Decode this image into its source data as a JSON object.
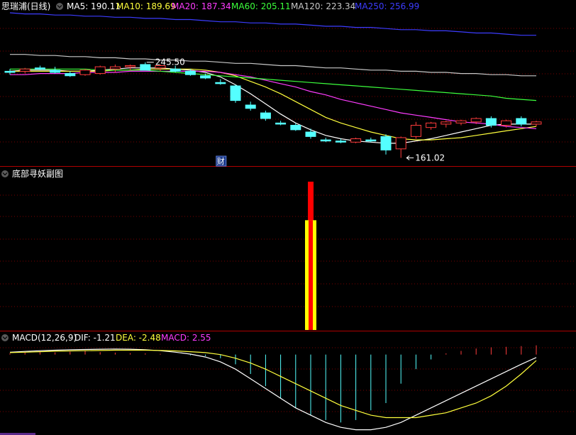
{
  "title": {
    "stock": "思瑞浦(日线)",
    "ma": [
      {
        "label": "MA5: 190.11",
        "color": "#ffffff"
      },
      {
        "label": "MA10: 189.69",
        "color": "#ffff3c"
      },
      {
        "label": "MA20: 187.34",
        "color": "#ff3cff"
      },
      {
        "label": "MA60: 205.11",
        "color": "#3cff3c"
      },
      {
        "label": "MA120: 223.34",
        "color": "#c8c8c8"
      },
      {
        "label": "MA250: 256.99",
        "color": "#3c3cff"
      }
    ]
  },
  "price_annotations": {
    "high": "245.50",
    "low": "161.02",
    "badge": "财"
  },
  "sub_panel": {
    "title": "底部寻妖副图"
  },
  "macd_panel": {
    "title": "MACD(12,26,9)",
    "dif": "DIF: -1.21",
    "dea": "DEA: -2.48",
    "macd": "MACD: 2.55",
    "colors": {
      "dif": "#ffffff",
      "dea": "#ffff3c",
      "macd": "#ff3cff"
    }
  },
  "chart_data": [
    {
      "type": "candlestick",
      "title": "思瑞浦(日线)",
      "ylim": [
        155,
        290
      ],
      "candles": [
        {
          "o": 238,
          "h": 240,
          "l": 235,
          "c": 237
        },
        {
          "o": 238,
          "h": 241,
          "l": 236,
          "c": 240
        },
        {
          "o": 241,
          "h": 243,
          "l": 239,
          "c": 240
        },
        {
          "o": 239,
          "h": 242,
          "l": 236,
          "c": 237
        },
        {
          "o": 236,
          "h": 238,
          "l": 233,
          "c": 234
        },
        {
          "o": 235,
          "h": 240,
          "l": 234,
          "c": 239
        },
        {
          "o": 236,
          "h": 243,
          "l": 235,
          "c": 242
        },
        {
          "o": 240,
          "h": 244,
          "l": 237,
          "c": 242
        },
        {
          "o": 242,
          "h": 244,
          "l": 239,
          "c": 243
        },
        {
          "o": 244,
          "h": 246,
          "l": 240,
          "c": 239
        },
        {
          "o": 241,
          "h": 244,
          "l": 238,
          "c": 243
        },
        {
          "o": 240,
          "h": 243,
          "l": 237,
          "c": 238
        },
        {
          "o": 238,
          "h": 240,
          "l": 234,
          "c": 235
        },
        {
          "o": 234,
          "h": 236,
          "l": 231,
          "c": 232
        },
        {
          "o": 228,
          "h": 231,
          "l": 226,
          "c": 227
        },
        {
          "o": 225,
          "h": 226,
          "l": 210,
          "c": 212
        },
        {
          "o": 208,
          "h": 211,
          "l": 203,
          "c": 205
        },
        {
          "o": 201,
          "h": 203,
          "l": 194,
          "c": 196
        },
        {
          "o": 192,
          "h": 194,
          "l": 190,
          "c": 191
        },
        {
          "o": 190,
          "h": 192,
          "l": 185,
          "c": 186
        },
        {
          "o": 184,
          "h": 187,
          "l": 178,
          "c": 180
        },
        {
          "o": 177,
          "h": 179,
          "l": 175,
          "c": 176
        },
        {
          "o": 176,
          "h": 178,
          "l": 174,
          "c": 175
        },
        {
          "o": 175,
          "h": 179,
          "l": 174,
          "c": 178
        },
        {
          "o": 177,
          "h": 179,
          "l": 175,
          "c": 176
        },
        {
          "o": 180,
          "h": 182,
          "l": 164,
          "c": 168
        },
        {
          "o": 169,
          "h": 180,
          "l": 161.02,
          "c": 179
        },
        {
          "o": 180,
          "h": 193,
          "l": 178,
          "c": 190
        },
        {
          "o": 188,
          "h": 193,
          "l": 186,
          "c": 192
        },
        {
          "o": 191,
          "h": 194,
          "l": 188,
          "c": 193
        },
        {
          "o": 192,
          "h": 195,
          "l": 190,
          "c": 194
        },
        {
          "o": 193,
          "h": 197,
          "l": 191,
          "c": 196
        },
        {
          "o": 196,
          "h": 198,
          "l": 188,
          "c": 190
        },
        {
          "o": 190,
          "h": 195,
          "l": 188,
          "c": 194
        },
        {
          "o": 196,
          "h": 198,
          "l": 189,
          "c": 191
        },
        {
          "o": 191,
          "h": 194,
          "l": 189,
          "c": 193
        }
      ],
      "ma_lines": [
        {
          "name": "MA5",
          "color": "#ffffff",
          "values": [
            238,
            239,
            239,
            239,
            238,
            238,
            239,
            240,
            241,
            241,
            241,
            240,
            239,
            237,
            233,
            226,
            218,
            209,
            200,
            192,
            186,
            181,
            178,
            176,
            175,
            174,
            174,
            176,
            178,
            181,
            184,
            187,
            190,
            191,
            191,
            191
          ]
        },
        {
          "name": "MA10",
          "color": "#ffff3c",
          "values": [
            238,
            238,
            238,
            238,
            238,
            238,
            238,
            239,
            239,
            240,
            240,
            240,
            240,
            239,
            237,
            234,
            229,
            224,
            218,
            211,
            204,
            197,
            192,
            188,
            184,
            181,
            178,
            177,
            177,
            178,
            179,
            181,
            183,
            185,
            187,
            189
          ]
        },
        {
          "name": "MA20",
          "color": "#ff3cff",
          "values": [
            235,
            235,
            236,
            236,
            236,
            237,
            237,
            237,
            238,
            238,
            238,
            238,
            238,
            238,
            237,
            235,
            233,
            230,
            227,
            224,
            220,
            217,
            213,
            210,
            207,
            204,
            201,
            199,
            197,
            195,
            193,
            192,
            191,
            189,
            188,
            187
          ]
        },
        {
          "name": "MA60",
          "color": "#3cff3c",
          "values": [
            240,
            240,
            240,
            240,
            240,
            240,
            239,
            239,
            239,
            239,
            238,
            237,
            236,
            235,
            234,
            233,
            232,
            231,
            230,
            229,
            228,
            227,
            226,
            225,
            224,
            223,
            222,
            221,
            220,
            219,
            218,
            217,
            216,
            214,
            213,
            212
          ]
        },
        {
          "name": "MA120",
          "color": "#c8c8c8",
          "values": [
            253,
            253,
            252,
            252,
            251,
            251,
            250,
            250,
            249,
            249,
            248,
            248,
            247,
            247,
            246,
            245,
            245,
            244,
            243,
            243,
            242,
            241,
            241,
            240,
            239,
            239,
            238,
            238,
            237,
            237,
            236,
            236,
            235,
            235,
            234,
            234
          ]
        },
        {
          "name": "MA250",
          "color": "#3c3cff",
          "values": [
            290,
            289,
            289,
            288,
            288,
            287,
            287,
            286,
            286,
            285,
            285,
            284,
            284,
            283,
            282,
            282,
            281,
            281,
            280,
            280,
            279,
            278,
            278,
            277,
            277,
            276,
            275,
            275,
            274,
            274,
            273,
            272,
            272,
            271,
            270,
            270
          ]
        }
      ]
    },
    {
      "type": "bar",
      "title": "底部寻妖副图",
      "ylim": [
        0,
        100
      ],
      "bars": [
        {
          "index": 20,
          "red_top": 100,
          "yellow_top": 74
        }
      ]
    },
    {
      "type": "line",
      "title": "MACD(12,26,9)",
      "ylim": [
        -32,
        4
      ],
      "histogram": [
        0.5,
        0.8,
        1.0,
        0.9,
        1.2,
        1.5,
        1.0,
        0.8,
        0.6,
        0.5,
        0.3,
        0.0,
        -0.3,
        -0.6,
        -1.5,
        -4,
        -8,
        -13,
        -18,
        -22,
        -25,
        -27,
        -28,
        -27,
        -23,
        -20,
        -12,
        -6,
        -2,
        0.5,
        1.5,
        2.5,
        3.0,
        3.2,
        3.5,
        3.8
      ],
      "series": [
        {
          "name": "DIF",
          "color": "#ffffff",
          "values": [
            1.0,
            1.3,
            1.6,
            1.8,
            2.0,
            2.1,
            2.2,
            2.3,
            2.2,
            2.0,
            1.6,
            1.0,
            0.2,
            -1.0,
            -3,
            -6,
            -10,
            -14,
            -18,
            -22,
            -25,
            -28,
            -30,
            -31,
            -31,
            -30,
            -28,
            -25,
            -22,
            -19,
            -16,
            -13,
            -10,
            -7,
            -4,
            -1.21
          ]
        },
        {
          "name": "DEA",
          "color": "#ffff3c",
          "values": [
            0.8,
            1.0,
            1.2,
            1.4,
            1.5,
            1.6,
            1.7,
            1.8,
            1.8,
            1.8,
            1.7,
            1.5,
            1.2,
            0.8,
            0,
            -1.5,
            -3.5,
            -6,
            -9,
            -12,
            -15,
            -18,
            -21,
            -23,
            -25,
            -26,
            -26,
            -26,
            -25,
            -24,
            -22,
            -20,
            -17,
            -13,
            -8,
            -2.48
          ]
        }
      ]
    }
  ]
}
